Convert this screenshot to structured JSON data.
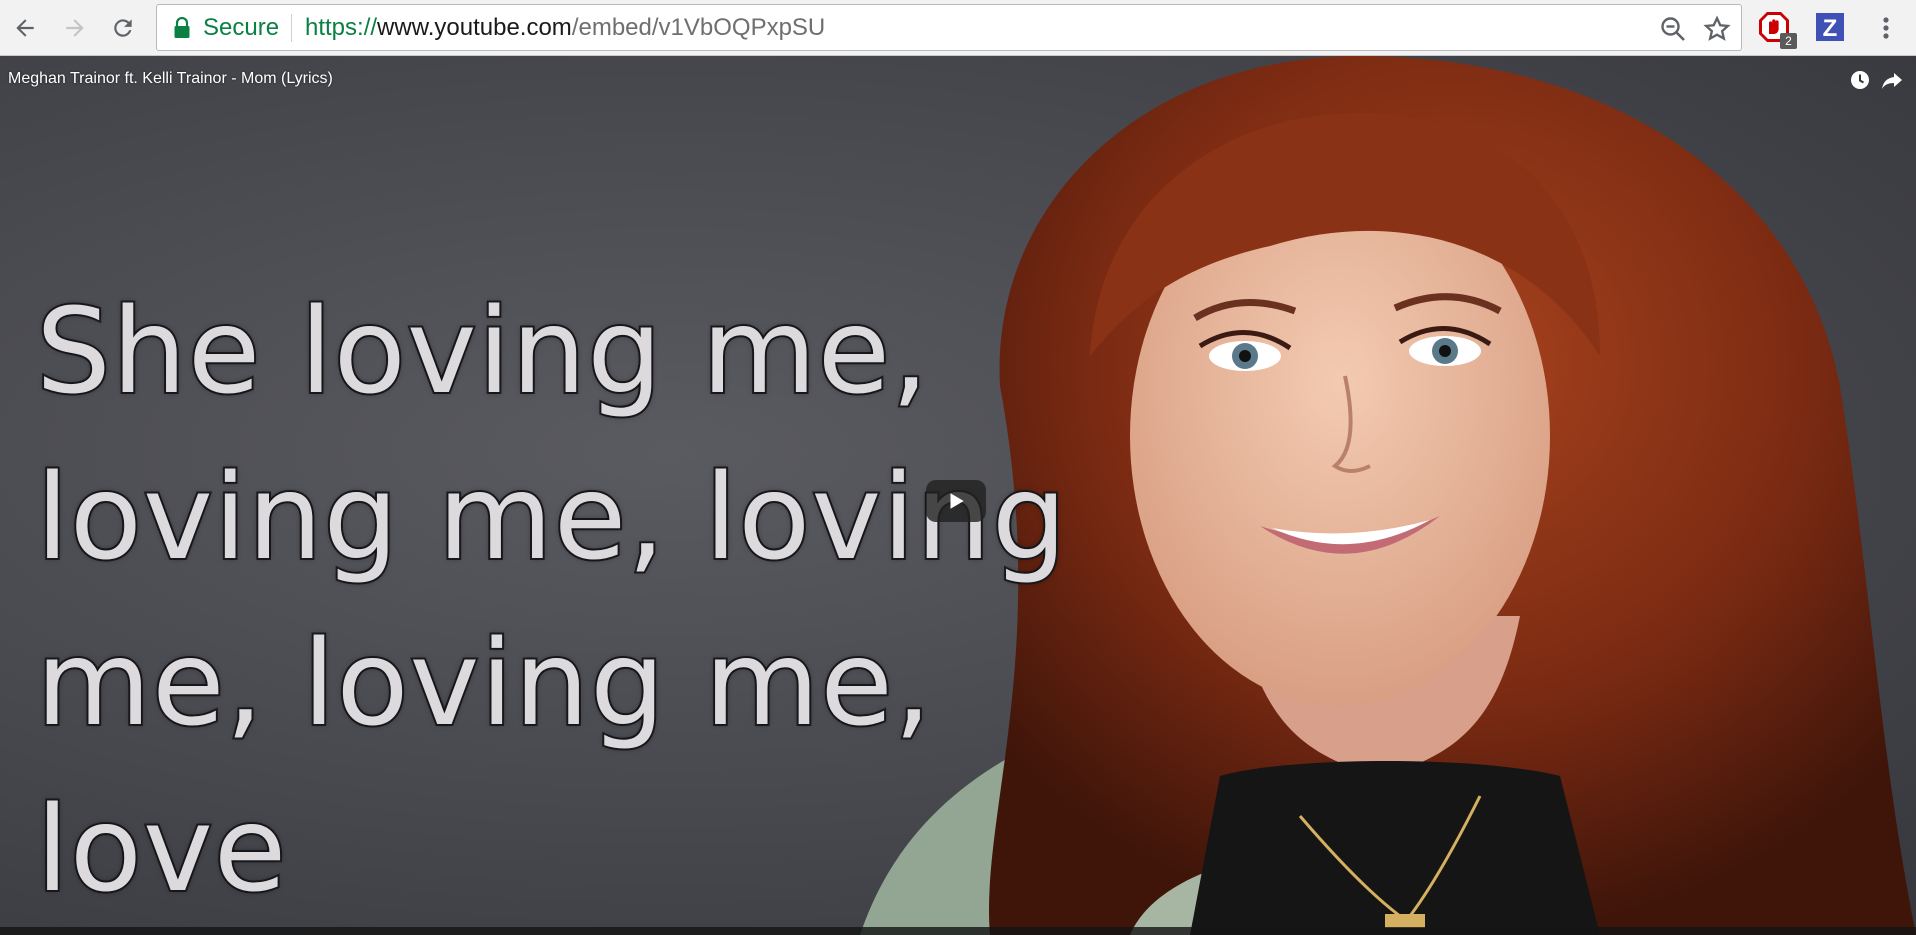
{
  "browser": {
    "secure_label": "Secure",
    "url_scheme": "https://",
    "url_host": "www.youtube.com",
    "url_path": "/embed/v1VbOQPxpSU",
    "extension_badge": "2",
    "extension_z_label": "Z"
  },
  "player": {
    "title": "Meghan Trainor ft. Kelli Trainor - Mom (Lyrics)",
    "lyrics": "She loving me,\nloving me, loving\nme, loving me, love"
  },
  "colors": {
    "secure_green": "#0b8043",
    "youtube_red": "#cc0000",
    "zotero_blue": "#3f51b5"
  }
}
